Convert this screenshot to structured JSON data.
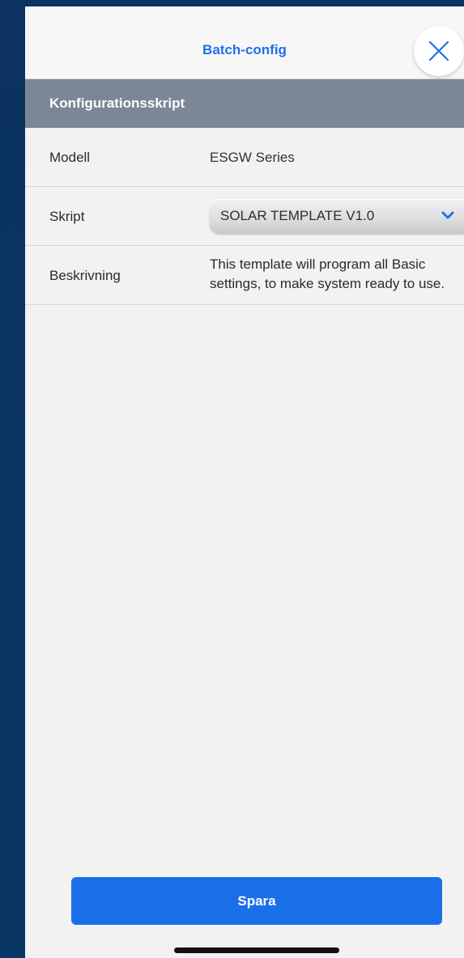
{
  "header": {
    "title": "Batch-config"
  },
  "section": {
    "title": "Konfigurationsskript"
  },
  "rows": {
    "model": {
      "label": "Modell",
      "value": "ESGW Series"
    },
    "script": {
      "label": "Skript",
      "selected": "SOLAR TEMPLATE V1.0"
    },
    "description": {
      "label": "Beskrivning",
      "line1": "This template will program all Basic",
      "line2": "settings, to make system ready to use."
    }
  },
  "actions": {
    "save_label": "Spara"
  },
  "icons": {
    "close": "close-icon",
    "dropdown": "chevron-down-icon"
  },
  "colors": {
    "accent": "#1f6fe8",
    "section_bar": "#7b8794",
    "backdrop": "#0a3464"
  }
}
